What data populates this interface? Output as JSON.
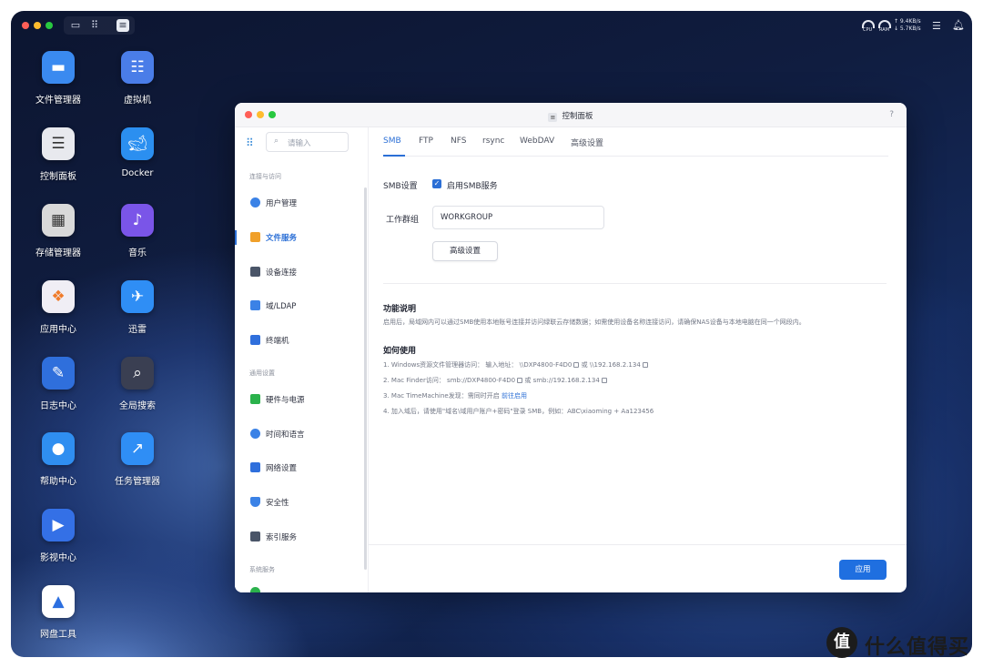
{
  "topbar": {
    "traffic_lights": [
      "#ff5f57",
      "#febc2e",
      "#28c840"
    ],
    "view_buttons": [
      "desktop-icon",
      "apps-grid-icon",
      "control-panel-icon"
    ],
    "cpu_label": "CPU",
    "ram_label": "RAM",
    "upload_rate": "↑ 9.4KB/s",
    "download_rate": "↓ 5.7KB/s"
  },
  "desktop": {
    "icons_left": [
      {
        "label": "文件管理器",
        "icon": "folder-icon",
        "color": "#3a8af0"
      },
      {
        "label": "控制面板",
        "icon": "sliders-icon",
        "color": "#e8e9ee"
      },
      {
        "label": "存储管理器",
        "icon": "disk-icon",
        "color": "#d9d9d9"
      },
      {
        "label": "应用中心",
        "icon": "app-center-icon",
        "color": "#f0eef5"
      },
      {
        "label": "日志中心",
        "icon": "log-icon",
        "color": "#2f6fdc"
      },
      {
        "label": "帮助中心",
        "icon": "lightbulb-icon",
        "color": "#2f8ef0"
      },
      {
        "label": "影视中心",
        "icon": "video-icon",
        "color": "#3470e6"
      },
      {
        "label": "网盘工具",
        "icon": "cloud-drive-icon",
        "color": "#2c6fe0"
      }
    ],
    "icons_right": [
      {
        "label": "虚拟机",
        "icon": "server-icon",
        "color": "#4a7de8"
      },
      {
        "label": "Docker",
        "icon": "docker-icon",
        "color": "#2b8ff0"
      },
      {
        "label": "音乐",
        "icon": "music-icon",
        "color": "#7a55e8"
      },
      {
        "label": "迅雷",
        "icon": "thunder-bird-icon",
        "color": "#2f8ef5"
      },
      {
        "label": "全局搜索",
        "icon": "search-icon",
        "color": "#3a3f52"
      },
      {
        "label": "任务管理器",
        "icon": "chart-icon",
        "color": "#2f8ef5"
      }
    ]
  },
  "window": {
    "title": "控制面板",
    "help": "?",
    "search_placeholder": "请输入",
    "sections": [
      {
        "title": "连接与访问",
        "items": [
          {
            "label": "用户管理",
            "icon": "user-icon",
            "color": "#3b82e6"
          },
          {
            "label": "文件服务",
            "icon": "folder-icon",
            "color": "#f0a02a",
            "active": true
          },
          {
            "label": "设备连接",
            "icon": "device-icon",
            "color": "#4a5568"
          },
          {
            "label": "域/LDAP",
            "icon": "domain-icon",
            "color": "#3b82e6"
          },
          {
            "label": "终端机",
            "icon": "terminal-icon",
            "color": "#2f6fdc"
          }
        ]
      },
      {
        "title": "通用设置",
        "items": [
          {
            "label": "硬件与电源",
            "icon": "battery-icon",
            "color": "#2bb24c"
          },
          {
            "label": "时间和语言",
            "icon": "globe-icon",
            "color": "#3b82e6"
          },
          {
            "label": "网络设置",
            "icon": "network-icon",
            "color": "#2f6fdc"
          },
          {
            "label": "安全性",
            "icon": "shield-icon",
            "color": "#3b82e6"
          },
          {
            "label": "索引服务",
            "icon": "index-icon",
            "color": "#4a5568"
          }
        ]
      },
      {
        "title": "系统服务",
        "items": []
      }
    ],
    "tabs": [
      "SMB",
      "FTP",
      "NFS",
      "rsync",
      "WebDAV",
      "高级设置"
    ],
    "active_tab": "SMB",
    "smb": {
      "setting_label": "SMB设置",
      "enable_label": "启用SMB服务",
      "enabled": true,
      "workgroup_label": "工作群组",
      "workgroup_value": "WORKGROUP",
      "advanced_button": "高级设置"
    },
    "info": {
      "title": "功能说明",
      "text": "启用后，局域网内可以通过SMB使用本地账号连接并访问绿联云存储数据；如需使用设备名称连接访问，请确保NAS设备与本地电脑在同一个网段内。"
    },
    "howto": {
      "title": "如何使用",
      "line1": "1. Windows资源文件管理器访问：  输入地址：  \\\\DXP4800-F4D0",
      "line1_or": "  或  ",
      "line1_ip": "\\\\192.168.2.134",
      "line2": "2. Mac Finder访问：  smb://DXP4800-F4D0",
      "line2_or": "  或  ",
      "line2_ip": "smb://192.168.2.134",
      "line3": "3. Mac TimeMachine发现：需同时开启  ",
      "line3_link": "前往启用",
      "line4": "4. 加入域后，请使用\"域名\\域用户账户+密码\"登录 SMB，例如：ABC\\xiaoming + Aa123456"
    },
    "apply_button": "应用"
  },
  "watermark": {
    "logo_char": "值",
    "text": "什么值得买"
  }
}
